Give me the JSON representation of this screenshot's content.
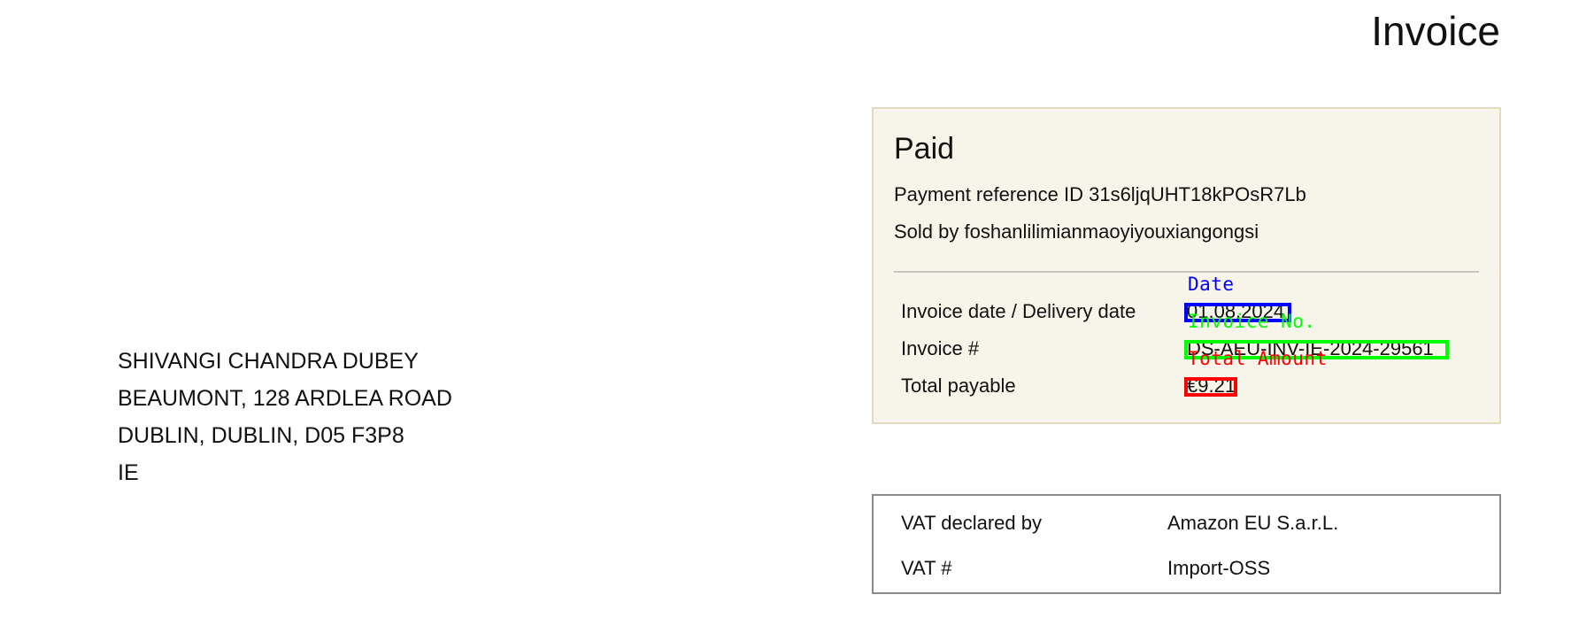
{
  "header": {
    "title": "Invoice"
  },
  "recipient": {
    "lines": [
      "SHIVANGI CHANDRA DUBEY",
      "BEAUMONT, 128 ARDLEA ROAD",
      "DUBLIN, DUBLIN, D05 F3P8",
      "IE"
    ]
  },
  "payment": {
    "status": "Paid",
    "reference": "Payment reference ID 31s6ljqUHT18kPOsR7Lb",
    "sold_by": "Sold by foshanlilimianmaoyiyouxiangongsi",
    "details": [
      {
        "label": "Invoice date / Delivery date",
        "value": "01.08.2024"
      },
      {
        "label": "Invoice #",
        "value": "DS-AEU-INV-IE-2024-29561"
      },
      {
        "label": "Total payable",
        "value": "€9.21"
      }
    ]
  },
  "annotations": {
    "date": {
      "label": "Date",
      "color": "#0000ff"
    },
    "invoice_number": {
      "label": "Invoice No.",
      "color": "#00ff00"
    },
    "total_amount": {
      "label": "Total Amount",
      "color": "#ff0000"
    }
  },
  "vat": {
    "rows": [
      {
        "label": "VAT declared by",
        "value": "Amazon EU S.a.r.L."
      },
      {
        "label": "VAT #",
        "value": "Import-OSS"
      }
    ]
  },
  "colors": {
    "paid_box_background": "#f7f5e9",
    "paid_box_border": "#e2d9c0",
    "vat_box_border": "#8a8a8a"
  }
}
